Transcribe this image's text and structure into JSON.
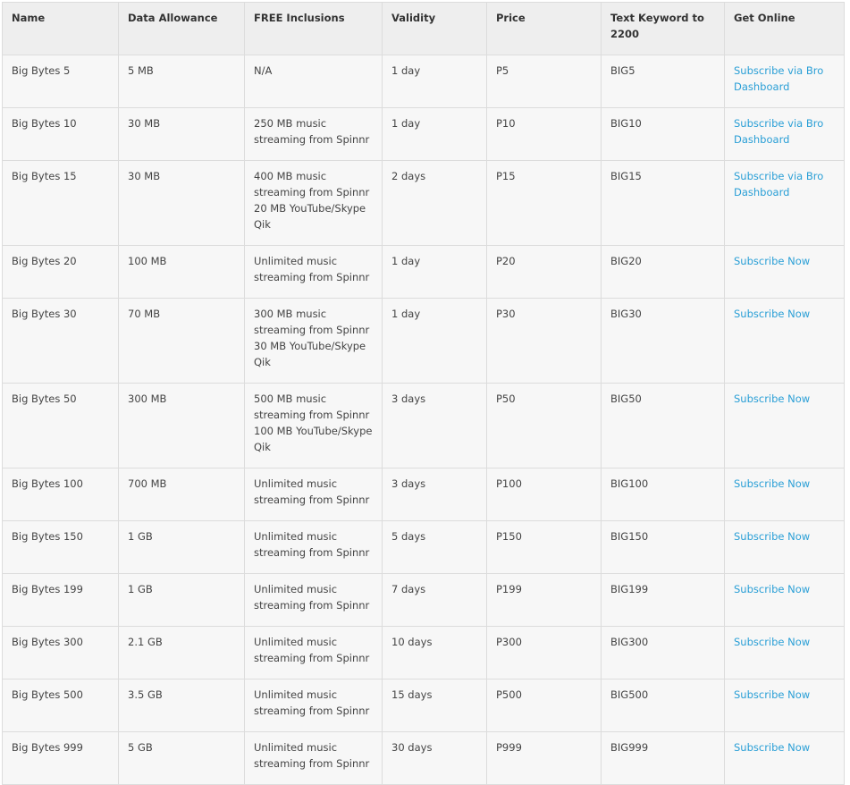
{
  "columns": [
    "Name",
    "Data Allowance",
    "FREE Inclusions",
    "Validity",
    "Price",
    "Text Keyword to 2200",
    "Get Online"
  ],
  "link_color": "#2a9fd6",
  "rows": [
    {
      "name": "Big Bytes 5",
      "data": "5 MB",
      "inclusions": [
        "N/A"
      ],
      "validity": "1 day",
      "price": "P5",
      "keyword": "BIG5",
      "link": "Subscribe via Bro Dashboard"
    },
    {
      "name": "Big Bytes 10",
      "data": "30 MB",
      "inclusions": [
        "250 MB music streaming from Spinnr"
      ],
      "validity": "1 day",
      "price": "P10",
      "keyword": "BIG10",
      "link": "Subscribe via Bro Dashboard"
    },
    {
      "name": "Big Bytes 15",
      "data": "30 MB",
      "inclusions": [
        "400 MB music streaming from Spinnr",
        "20 MB YouTube/Skype Qik"
      ],
      "validity": "2 days",
      "price": "P15",
      "keyword": "BIG15",
      "link": "Subscribe via Bro Dashboard"
    },
    {
      "name": "Big Bytes 20",
      "data": "100 MB",
      "inclusions": [
        "Unlimited music streaming from Spinnr"
      ],
      "validity": "1 day",
      "price": "P20",
      "keyword": "BIG20",
      "link": "Subscribe Now"
    },
    {
      "name": "Big Bytes 30",
      "data": "70 MB",
      "inclusions": [
        "300 MB music streaming from Spinnr",
        "30 MB YouTube/Skype Qik"
      ],
      "validity": "1 day",
      "price": "P30",
      "keyword": "BIG30",
      "link": "Subscribe Now"
    },
    {
      "name": "Big Bytes 50",
      "data": "300 MB",
      "inclusions": [
        "500 MB music streaming from Spinnr",
        "100 MB YouTube/Skype Qik"
      ],
      "validity": "3 days",
      "price": "P50",
      "keyword": "BIG50",
      "link": "Subscribe Now"
    },
    {
      "name": "Big Bytes 100",
      "data": "700 MB",
      "inclusions": [
        "Unlimited music streaming from Spinnr"
      ],
      "validity": "3 days",
      "price": "P100",
      "keyword": "BIG100",
      "link": "Subscribe Now"
    },
    {
      "name": "Big Bytes 150",
      "data": "1 GB",
      "inclusions": [
        "Unlimited music streaming from Spinnr"
      ],
      "validity": "5 days",
      "price": "P150",
      "keyword": "BIG150",
      "link": "Subscribe Now"
    },
    {
      "name": "Big Bytes 199",
      "data": "1 GB",
      "inclusions": [
        "Unlimited music streaming from Spinnr"
      ],
      "validity": "7 days",
      "price": "P199",
      "keyword": "BIG199",
      "link": "Subscribe Now"
    },
    {
      "name": "Big Bytes 300",
      "data": "2.1 GB",
      "inclusions": [
        "Unlimited music streaming from Spinnr"
      ],
      "validity": "10 days",
      "price": "P300",
      "keyword": "BIG300",
      "link": "Subscribe Now"
    },
    {
      "name": "Big Bytes 500",
      "data": "3.5 GB",
      "inclusions": [
        "Unlimited music streaming from Spinnr"
      ],
      "validity": "15 days",
      "price": "P500",
      "keyword": "BIG500",
      "link": "Subscribe Now"
    },
    {
      "name": "Big Bytes 999",
      "data": "5 GB",
      "inclusions": [
        "Unlimited music streaming from Spinnr"
      ],
      "validity": "30 days",
      "price": "P999",
      "keyword": "BIG999",
      "link": "Subscribe Now"
    }
  ]
}
